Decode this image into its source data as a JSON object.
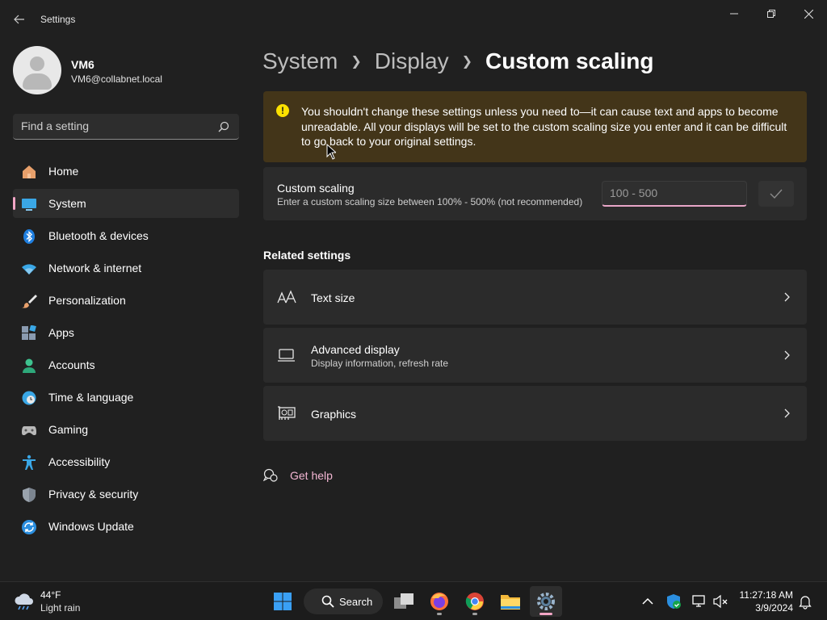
{
  "window": {
    "title": "Settings"
  },
  "user": {
    "name": "VM6",
    "email": "VM6@collabnet.local"
  },
  "search": {
    "placeholder": "Find a setting"
  },
  "sidebar": {
    "items": [
      {
        "label": "Home",
        "icon": "home-icon"
      },
      {
        "label": "System",
        "icon": "system-icon",
        "active": true
      },
      {
        "label": "Bluetooth & devices",
        "icon": "bluetooth-icon"
      },
      {
        "label": "Network & internet",
        "icon": "wifi-icon"
      },
      {
        "label": "Personalization",
        "icon": "brush-icon"
      },
      {
        "label": "Apps",
        "icon": "apps-icon"
      },
      {
        "label": "Accounts",
        "icon": "accounts-icon"
      },
      {
        "label": "Time & language",
        "icon": "clock-globe-icon"
      },
      {
        "label": "Gaming",
        "icon": "gamepad-icon"
      },
      {
        "label": "Accessibility",
        "icon": "accessibility-icon"
      },
      {
        "label": "Privacy & security",
        "icon": "shield-icon"
      },
      {
        "label": "Windows Update",
        "icon": "update-icon"
      }
    ]
  },
  "breadcrumb": {
    "items": [
      "System",
      "Display",
      "Custom scaling"
    ]
  },
  "warning": {
    "text": "You shouldn't change these settings unless you need to—it can cause text and apps to become unreadable. All your displays will be set to the custom scaling size you enter and it can be difficult to go back to your original settings."
  },
  "custom_scaling": {
    "title": "Custom scaling",
    "description": "Enter a custom scaling size between 100% - 500% (not recommended)",
    "input_value": "",
    "input_placeholder": "100 - 500"
  },
  "related": {
    "heading": "Related settings",
    "items": [
      {
        "title": "Text size",
        "subtitle": "",
        "icon": "text-size-icon"
      },
      {
        "title": "Advanced display",
        "subtitle": "Display information, refresh rate",
        "icon": "monitor-icon"
      },
      {
        "title": "Graphics",
        "subtitle": "",
        "icon": "graphics-card-icon"
      }
    ]
  },
  "help": {
    "label": "Get help"
  },
  "taskbar": {
    "weather": {
      "temp": "44°F",
      "desc": "Light rain"
    },
    "search_label": "Search",
    "clock": {
      "time": "11:27:18 AM",
      "date": "3/9/2024"
    }
  },
  "colors": {
    "accent": "#f3a6c6",
    "warning_bg": "#433519",
    "warning_icon": "#fce100",
    "background": "#202020"
  }
}
